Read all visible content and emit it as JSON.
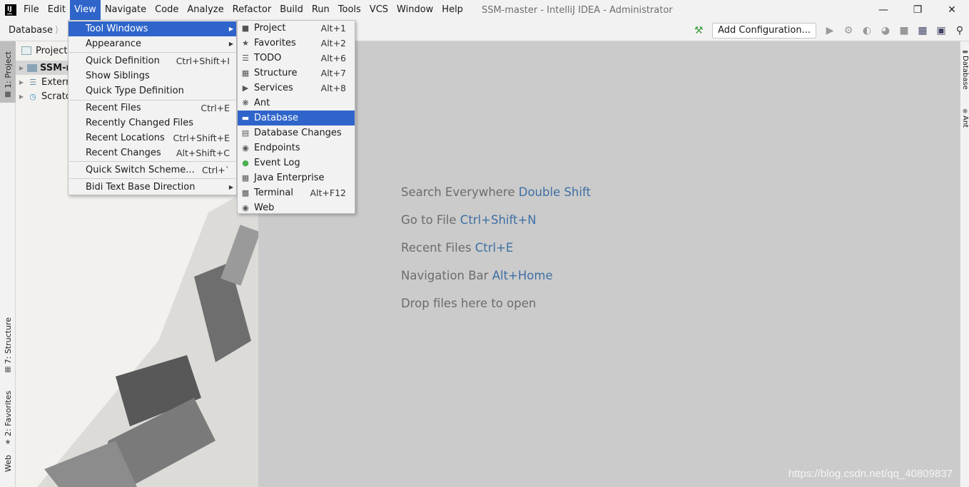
{
  "menubar": {
    "items": [
      "File",
      "Edit",
      "View",
      "Navigate",
      "Code",
      "Analyze",
      "Refactor",
      "Build",
      "Run",
      "Tools",
      "VCS",
      "Window",
      "Help"
    ],
    "active": "View",
    "window_title": "SSM-master - IntelliJ IDEA - Administrator"
  },
  "navbar": {
    "breadcrumb": "Database",
    "add_configuration": "Add Configuration..."
  },
  "left_strip": {
    "tabs": [
      "1: Project",
      "7: Structure",
      "2: Favorites",
      "Web"
    ]
  },
  "right_strip": {
    "tabs": [
      "Database",
      "Ant"
    ]
  },
  "project_panel": {
    "header": "Project",
    "tree": [
      "SSM-m",
      "Extern",
      "Scratc"
    ]
  },
  "view_menu": {
    "items": [
      {
        "label": "Tool Windows",
        "shortcut": "",
        "submenu": true
      },
      {
        "label": "Appearance",
        "shortcut": "",
        "submenu": true
      },
      {
        "label": "Quick Definition",
        "shortcut": "Ctrl+Shift+I"
      },
      {
        "label": "Show Siblings",
        "shortcut": ""
      },
      {
        "label": "Quick Type Definition",
        "shortcut": ""
      },
      {
        "label": "Recent Files",
        "shortcut": "Ctrl+E"
      },
      {
        "label": "Recently Changed Files",
        "shortcut": ""
      },
      {
        "label": "Recent Locations",
        "shortcut": "Ctrl+Shift+E"
      },
      {
        "label": "Recent Changes",
        "shortcut": "Alt+Shift+C"
      },
      {
        "label": "Quick Switch Scheme...",
        "shortcut": "Ctrl+`"
      },
      {
        "label": "Bidi Text Base Direction",
        "shortcut": "",
        "submenu": true
      }
    ]
  },
  "tool_windows_menu": {
    "items": [
      {
        "label": "Project",
        "shortcut": "Alt+1",
        "icon": "folder-icon"
      },
      {
        "label": "Favorites",
        "shortcut": "Alt+2",
        "icon": "star-icon"
      },
      {
        "label": "TODO",
        "shortcut": "Alt+6",
        "icon": "list-icon"
      },
      {
        "label": "Structure",
        "shortcut": "Alt+7",
        "icon": "structure-icon"
      },
      {
        "label": "Services",
        "shortcut": "Alt+8",
        "icon": "services-icon"
      },
      {
        "label": "Ant",
        "shortcut": "",
        "icon": "ant-icon"
      },
      {
        "label": "Database",
        "shortcut": "",
        "icon": "database-icon"
      },
      {
        "label": "Database Changes",
        "shortcut": "",
        "icon": "database-changes-icon"
      },
      {
        "label": "Endpoints",
        "shortcut": "",
        "icon": "endpoints-icon"
      },
      {
        "label": "Event Log",
        "shortcut": "",
        "icon": "event-log-icon"
      },
      {
        "label": "Java Enterprise",
        "shortcut": "",
        "icon": "java-enterprise-icon"
      },
      {
        "label": "Terminal",
        "shortcut": "Alt+F12",
        "icon": "terminal-icon"
      },
      {
        "label": "Web",
        "shortcut": "",
        "icon": "web-icon"
      }
    ],
    "highlighted": "Database"
  },
  "editor_hints": [
    {
      "text": "Search Everywhere",
      "key": "Double Shift"
    },
    {
      "text": "Go to File",
      "key": "Ctrl+Shift+N"
    },
    {
      "text": "Recent Files",
      "key": "Ctrl+E"
    },
    {
      "text": "Navigation Bar",
      "key": "Alt+Home"
    },
    {
      "text": "Drop files here to open",
      "key": ""
    }
  ],
  "watermark": "https://blog.csdn.net/qq_40809837",
  "colors": {
    "selection": "#2f65ca",
    "hint_key": "#3e6fa3",
    "editor_bg": "#cbcbcb"
  }
}
